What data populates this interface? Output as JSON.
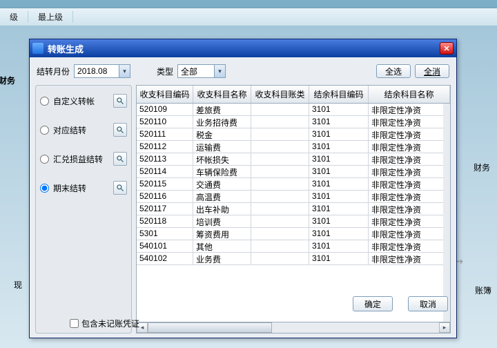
{
  "bg": {
    "menu1": "级",
    "menu2": "最上级",
    "label1": "财务",
    "label2": "现",
    "right1": "财务",
    "right2": "账簿",
    "arrow": "⤑"
  },
  "modal": {
    "title": "转账生成",
    "period_label": "结转月份",
    "period_value": "2018.08",
    "type_label": "类型",
    "type_value": "全部",
    "select_all": "全选",
    "deselect_all": "全消",
    "ok": "确定",
    "cancel": "取消",
    "include_unposted": "包含未记账凭证"
  },
  "side": {
    "custom": "自定义转帐",
    "correspond": "对应结转",
    "exchange": "汇兑损益结转",
    "period_end": "期末结转"
  },
  "cols": [
    "收支科目编码",
    "收支科目名称",
    "收支科目账类",
    "结余科目编码",
    "结余科目名称"
  ],
  "rows": [
    {
      "c0": "520109",
      "c1": "差旅费",
      "c2": "",
      "c3": "3101",
      "c4": "非限定性净资"
    },
    {
      "c0": "520110",
      "c1": "业务招待费",
      "c2": "",
      "c3": "3101",
      "c4": "非限定性净资"
    },
    {
      "c0": "520111",
      "c1": "税金",
      "c2": "",
      "c3": "3101",
      "c4": "非限定性净资"
    },
    {
      "c0": "520112",
      "c1": "运输费",
      "c2": "",
      "c3": "3101",
      "c4": "非限定性净资"
    },
    {
      "c0": "520113",
      "c1": "坏帐损失",
      "c2": "",
      "c3": "3101",
      "c4": "非限定性净资"
    },
    {
      "c0": "520114",
      "c1": "车辆保险费",
      "c2": "",
      "c3": "3101",
      "c4": "非限定性净资"
    },
    {
      "c0": "520115",
      "c1": "交通费",
      "c2": "",
      "c3": "3101",
      "c4": "非限定性净资"
    },
    {
      "c0": "520116",
      "c1": "高温费",
      "c2": "",
      "c3": "3101",
      "c4": "非限定性净资"
    },
    {
      "c0": "520117",
      "c1": "出车补助",
      "c2": "",
      "c3": "3101",
      "c4": "非限定性净资"
    },
    {
      "c0": "520118",
      "c1": "培训费",
      "c2": "",
      "c3": "3101",
      "c4": "非限定性净资"
    },
    {
      "c0": "5301",
      "c1": "筹资费用",
      "c2": "",
      "c3": "3101",
      "c4": "非限定性净资"
    },
    {
      "c0": "540101",
      "c1": "其他",
      "c2": "",
      "c3": "3101",
      "c4": "非限定性净资"
    },
    {
      "c0": "540102",
      "c1": "业务费",
      "c2": "",
      "c3": "3101",
      "c4": "非限定性净资"
    }
  ]
}
